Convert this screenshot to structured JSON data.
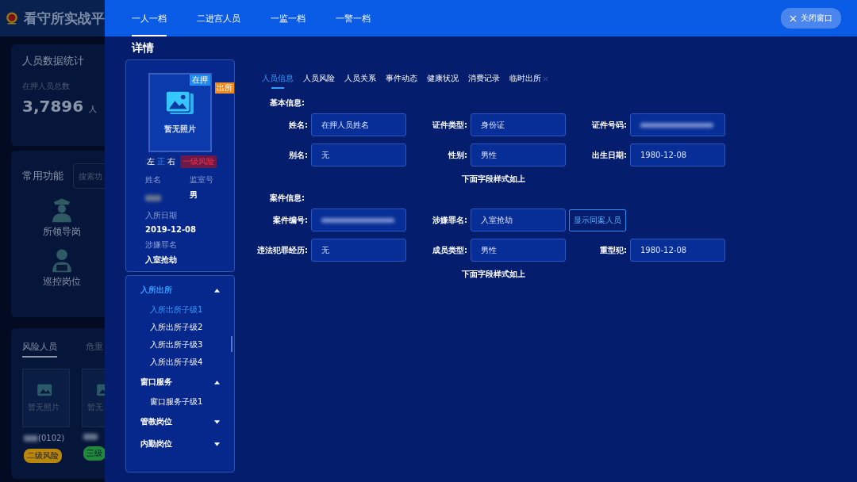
{
  "background": {
    "app_title": "看守所实战平",
    "stats": {
      "title": "人员数据统计",
      "label": "在押人员总数",
      "value": "3,7896",
      "unit": "人"
    },
    "functions": {
      "title": "常用功能",
      "search": {
        "placeholder": "搜索功"
      },
      "items": [
        {
          "label": "所领导岗",
          "kind": "officer"
        },
        {
          "label": "巡控岗位",
          "kind": "worker"
        }
      ]
    },
    "people": {
      "tabs": [
        {
          "label": "风险人员",
          "selected": true
        },
        {
          "label": "危重",
          "selected": false
        }
      ],
      "cards": [
        {
          "photo_text": "暂无照片",
          "name_suffix": "(0102)",
          "badge": "二级风险",
          "color": "#b8860b"
        },
        {
          "photo_text": "暂无",
          "badge": "三级",
          "color": "#1f8a3a"
        }
      ]
    }
  },
  "modal": {
    "tabs": [
      {
        "label": "一人一档",
        "selected": true
      },
      {
        "label": "二进宫人员",
        "selected": false
      },
      {
        "label": "一监一档",
        "selected": false
      },
      {
        "label": "一警一档",
        "selected": false
      }
    ],
    "close_button": "关闭窗口",
    "title": "详情",
    "profile": {
      "photo_text": "暂无照片",
      "status_badge": "在押",
      "out_badge": "出所",
      "views": [
        {
          "label": "左",
          "selected": false
        },
        {
          "label": "正",
          "selected": true
        },
        {
          "label": "右",
          "selected": false
        }
      ],
      "risk": "一级风险",
      "fields": [
        {
          "label": "姓名",
          "kind": "redacted"
        },
        {
          "label": "监室号",
          "value": "男",
          "kind": "text"
        },
        {
          "label": "入所日期",
          "value": "2019-12-08",
          "kind": "text"
        },
        {
          "label": "涉嫌罪名",
          "value": "入室抢劫",
          "kind": "text"
        }
      ]
    },
    "menu": [
      {
        "label": "入所出所",
        "expanded": true,
        "selected": true,
        "children": [
          {
            "label": "入所出所子级1",
            "selected": true
          },
          {
            "label": "入所出所子级2",
            "selected": false
          },
          {
            "label": "入所出所子级3",
            "selected": false
          },
          {
            "label": "入所出所子级4",
            "selected": false
          }
        ]
      },
      {
        "label": "窗口服务",
        "expanded": true,
        "selected": false,
        "children": [
          {
            "label": "窗口服务子级1",
            "selected": false
          }
        ]
      },
      {
        "label": "管教岗位",
        "expanded": false,
        "selected": false
      },
      {
        "label": "内勤岗位",
        "expanded": false,
        "selected": false
      }
    ],
    "subtabs": [
      {
        "label": "人员信息",
        "selected": true
      },
      {
        "label": "人员风险",
        "selected": false
      },
      {
        "label": "人员关系",
        "selected": false
      },
      {
        "label": "事件动态",
        "selected": false
      },
      {
        "label": "健康状况",
        "selected": false
      },
      {
        "label": "消费记录",
        "selected": false
      },
      {
        "label": "临时出所",
        "selected": false
      }
    ],
    "sections": [
      {
        "title": "基本信息:",
        "rows": [
          [
            {
              "label": "姓名:",
              "value": "在押人员姓名",
              "kind": "text"
            },
            {
              "label": "证件类型:",
              "value": "身份证",
              "kind": "text"
            },
            {
              "label": "证件号码:",
              "kind": "redacted"
            }
          ],
          [
            {
              "label": "别名:",
              "value": "无",
              "kind": "text"
            },
            {
              "label": "性别:",
              "value": "男性",
              "kind": "text"
            },
            {
              "label": "出生日期:",
              "value": "1980-12-08",
              "kind": "text"
            }
          ]
        ],
        "note": "下面字段样式如上"
      },
      {
        "title": "案件信息:",
        "rows": [
          [
            {
              "label": "案件编号:",
              "kind": "redacted"
            },
            {
              "label": "涉嫌罪名:",
              "value": "入室抢劫",
              "kind": "text"
            }
          ],
          [
            {
              "label": "违法犯罪经历:",
              "value": "无",
              "kind": "text"
            },
            {
              "label": "成员类型:",
              "value": "男性",
              "kind": "text"
            },
            {
              "label": "重型犯:",
              "value": "1980-12-08",
              "kind": "text"
            }
          ]
        ],
        "note": "下面字段样式如上",
        "action": "显示同案人员"
      }
    ]
  }
}
